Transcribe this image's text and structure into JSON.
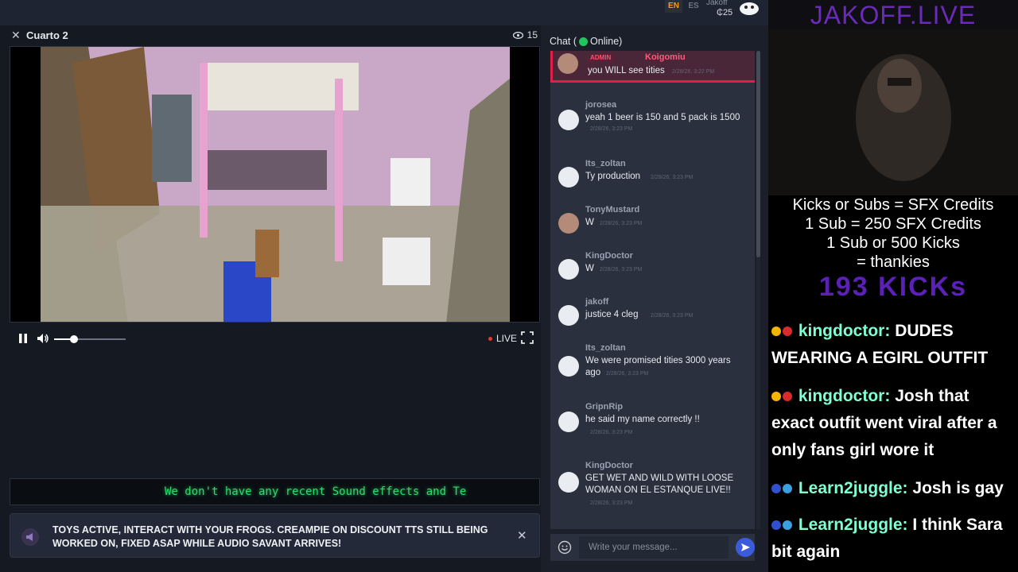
{
  "topbar": {
    "lang_en": "EN",
    "lang_es": "ES",
    "user_name": "Jakoff",
    "credits": "₵25"
  },
  "stream": {
    "close_icon": "close-icon",
    "room_title": "Cuarto 2",
    "viewer_count": "15",
    "live_label": "LIVE",
    "volume_level": 0.28
  },
  "ticker": {
    "text": "We don't have any recent Sound effects and Te"
  },
  "announcement": {
    "text": "TOYS ACTIVE, INTERACT WITH YOUR FROGS. CREAMPIE ON DISCOUNT TTS STILL BEING WORKED ON, FIXED ASAP WHILE AUDIO SAVANT ARRIVES!"
  },
  "chat": {
    "header_prefix": "Chat (",
    "header_status": "Online)",
    "input_placeholder": "Write your message...",
    "messages": [
      {
        "badge": "ADMIN",
        "name": "Koigomiu",
        "text": "you WILL see tities",
        "time": "2/28/26, 3:22 PM"
      },
      {
        "name": "jorosea",
        "text": "yeah 1 beer is 150 and 5 pack is 1500",
        "time": "2/28/26, 3:23 PM"
      },
      {
        "name": "Its_zoltan",
        "text": "Ty production",
        "time": "2/28/26, 3:23 PM"
      },
      {
        "name": "TonyMustard",
        "text": "W",
        "time": "2/28/26, 3:23 PM"
      },
      {
        "name": "KingDoctor",
        "text": "W",
        "time": "2/28/26, 3:23 PM"
      },
      {
        "name": "jakoff",
        "text": "justice 4 cleg",
        "time": "2/28/26, 3:23 PM"
      },
      {
        "name": "Its_zoltan",
        "text": "We were promised tities 3000 years ago",
        "time": "2/28/26, 3:23 PM"
      },
      {
        "name": "GripnRip",
        "text": "he said my name correctly !!",
        "time": "2/28/26, 3:23 PM"
      },
      {
        "name": "KingDoctor",
        "text": "GET WET AND WILD WITH LOOSE WOMAN ON EL ESTANQUE LIVE!!",
        "time": "2/28/26, 3:23 PM"
      }
    ]
  },
  "overlay": {
    "title": "JAKOFF.LIVE",
    "rules": [
      "Kicks or Subs = SFX Credits",
      "1 Sub = 250 SFX Credits",
      "1 Sub or 500 Kicks",
      "= thankies"
    ],
    "kicks": "193 KICKs",
    "chat": [
      {
        "user": "kingdoctor:",
        "text": "DUDES WEARING A EGIRL OUTFIT"
      },
      {
        "user": "kingdoctor:",
        "text": "Josh that exact outfit went viral after a only fans girl wore it"
      },
      {
        "user": "Learn2juggle:",
        "text": "Josh is gay"
      },
      {
        "user": "Learn2juggle:",
        "text": "I think Sara bit again"
      }
    ]
  },
  "colors": {
    "accent_purple": "#6a2bb8",
    "online_green": "#22c55e",
    "admin_red": "#e11d48",
    "ticker_green": "#2fd86a"
  }
}
